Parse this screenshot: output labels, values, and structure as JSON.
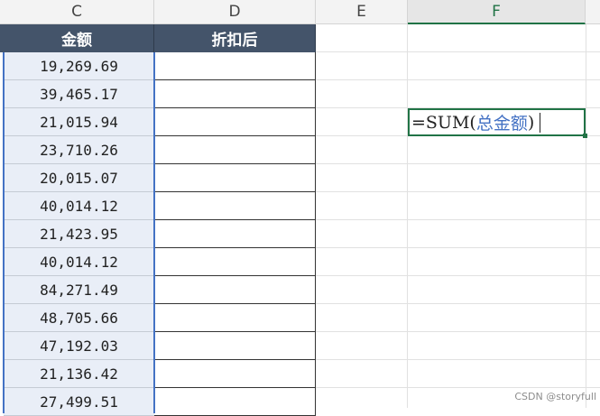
{
  "columns": [
    "C",
    "D",
    "E",
    "F"
  ],
  "active_column": "F",
  "headers": {
    "amount": "金额",
    "discounted": "折扣后"
  },
  "amounts": [
    "19,269.69",
    "39,465.17",
    "21,015.94",
    "23,710.26",
    "20,015.07",
    "40,014.12",
    "21,423.95",
    "40,014.12",
    "84,271.49",
    "48,705.66",
    "47,192.03",
    "21,136.42",
    "27,499.51"
  ],
  "formula": {
    "prefix": "=SUM(",
    "name_ref": "总金额",
    "suffix": ")"
  },
  "watermark": "CSDN @storyfull",
  "colors": {
    "header_bg": "#44546a",
    "selection_blue": "#4472c4",
    "excel_green": "#217346"
  }
}
